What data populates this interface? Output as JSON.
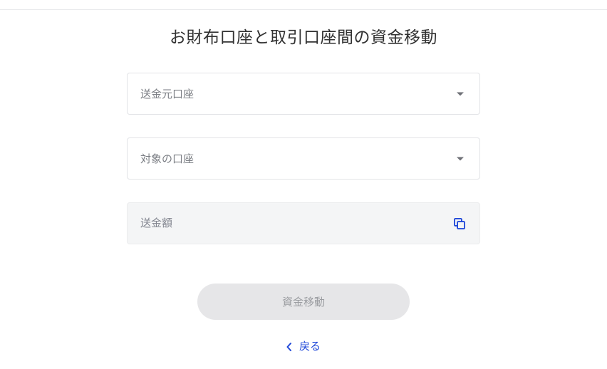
{
  "title": "お財布口座と取引口座間の資金移動",
  "form": {
    "source_account_label": "送金元口座",
    "target_account_label": "対象の口座",
    "amount_placeholder": "送金額"
  },
  "submit_label": "資金移動",
  "back_label": "戻る",
  "colors": {
    "accent": "#2048d9",
    "disabled_bg": "#e6e6e8",
    "disabled_text": "#9a9ca0"
  }
}
